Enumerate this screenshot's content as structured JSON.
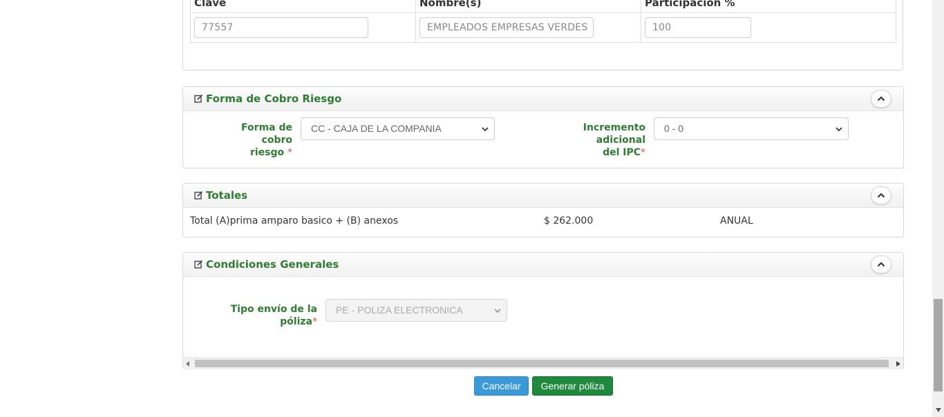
{
  "participants": {
    "headers": [
      "Clave",
      "Nombre(s)",
      "Participación %"
    ],
    "row": {
      "clave": "77557",
      "nombre": "EMPLEADOS EMPRESAS VERDES",
      "participacion": "100"
    }
  },
  "forma_cobro": {
    "title": "Forma de Cobro Riesgo",
    "forma_label_1": "Forma de cobro",
    "forma_label_2": "riesgo",
    "forma_value": "CC - CAJA DE LA COMPANIA",
    "incremento_label_1": "Incremento adicional",
    "incremento_label_2": "del IPC",
    "incremento_value": "0 - 0",
    "required_mark": "*"
  },
  "totales": {
    "title": "Totales",
    "label": "Total (A)prima amparo basico + (B) anexos",
    "amount": "$ 262.000",
    "periodicity": "ANUAL"
  },
  "condiciones": {
    "title": "Condiciones Generales",
    "tipo_label_1": "Tipo envío de la",
    "tipo_label_2": "póliza",
    "tipo_value": "PE - POLIZA ELECTRONICA",
    "required_mark": "*"
  },
  "actions": {
    "cancel": "Cancelar",
    "generate": "Generar póliza"
  },
  "colors": {
    "accent_green": "#2e7d32",
    "button_blue": "#3a9ad9",
    "button_green": "#1f8a3d"
  }
}
